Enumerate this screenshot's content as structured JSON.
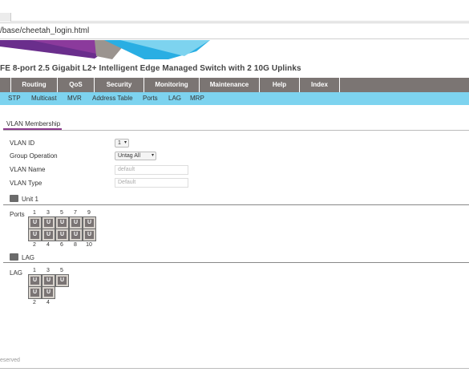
{
  "browser": {
    "address": "/base/cheetah_login.html"
  },
  "page": {
    "title": "FE 8-port 2.5 Gigabit L2+ Intelligent Edge Managed Switch with 2 10G Uplinks"
  },
  "main_nav": {
    "items": [
      {
        "label": ""
      },
      {
        "label": "Routing"
      },
      {
        "label": "QoS"
      },
      {
        "label": "Security"
      },
      {
        "label": "Monitoring"
      },
      {
        "label": "Maintenance"
      },
      {
        "label": "Help"
      },
      {
        "label": "Index"
      },
      {
        "label": ""
      }
    ]
  },
  "sub_nav": {
    "items": [
      "STP",
      "Multicast",
      "MVR",
      "Address Table",
      "Ports",
      "LAG",
      "MRP"
    ]
  },
  "section": {
    "title": "VLAN Membership"
  },
  "form": {
    "vlan_id": {
      "label": "VLAN ID",
      "value": "1"
    },
    "group_operation": {
      "label": "Group Operation",
      "value": "Untag All"
    },
    "vlan_name": {
      "label": "VLAN Name",
      "value": "default"
    },
    "vlan_type": {
      "label": "VLAN Type",
      "value": "Default"
    }
  },
  "unit": {
    "title": "Unit 1",
    "ports_label": "Ports",
    "top_numbers": [
      "1",
      "3",
      "5",
      "7",
      "9"
    ],
    "bottom_numbers": [
      "2",
      "4",
      "6",
      "8",
      "10"
    ],
    "port_symbol": "U"
  },
  "lag": {
    "title": "LAG",
    "label": "LAG",
    "top_numbers": [
      "1",
      "3",
      "5"
    ],
    "bottom_numbers": [
      "2",
      "4"
    ],
    "port_symbol": "U"
  },
  "footer": {
    "text": "eserved"
  },
  "colors": {
    "main_nav": "#7b7573",
    "sub_nav": "#7dd3ef",
    "accent": "#8b3a8b"
  },
  "icons": [
    "folder-icon",
    "chevron-down-icon"
  ]
}
